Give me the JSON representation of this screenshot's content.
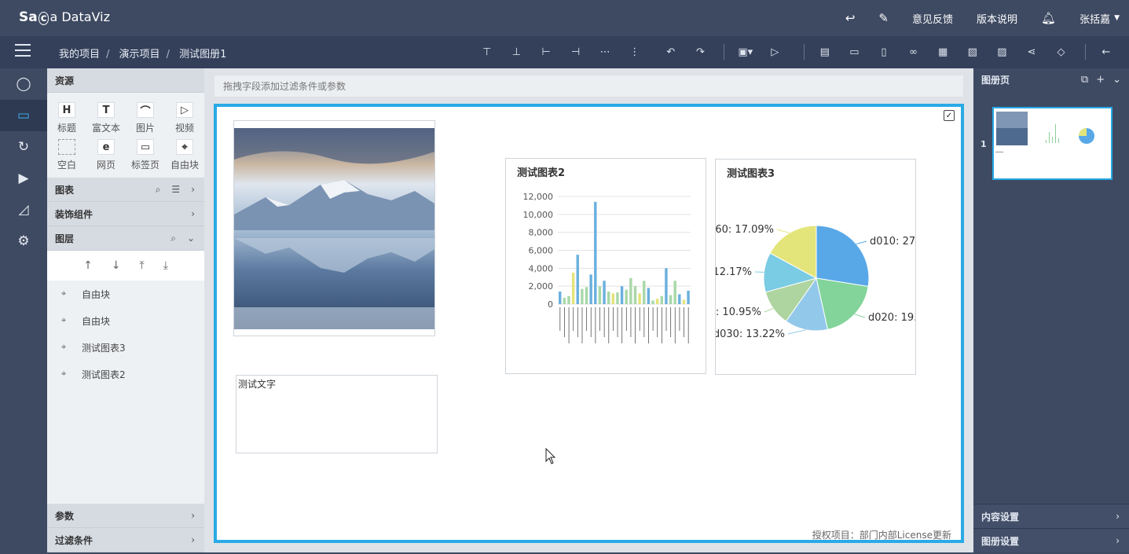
{
  "app": {
    "logo_a": "Sa",
    "logo_mid": "c",
    "logo_b": "a DataViz"
  },
  "topnav": {
    "feedback": "意见反馈",
    "release_notes": "版本说明",
    "user": "张括嘉"
  },
  "breadcrumb": {
    "items": [
      "我的项目",
      "演示项目",
      "测试图册1"
    ]
  },
  "left": {
    "resources_title": "资源",
    "resources": [
      {
        "label": "标题",
        "glyph": "H",
        "icon": "heading-icon"
      },
      {
        "label": "富文本",
        "glyph": "T",
        "icon": "rich-text-icon"
      },
      {
        "label": "图片",
        "glyph": "⌒",
        "icon": "image-icon"
      },
      {
        "label": "视频",
        "glyph": "▷",
        "icon": "video-icon"
      },
      {
        "label": "空白",
        "glyph": "",
        "icon": "blank-icon"
      },
      {
        "label": "网页",
        "glyph": "e",
        "icon": "webpage-icon"
      },
      {
        "label": "标签页",
        "glyph": "▭",
        "icon": "tab-page-icon"
      },
      {
        "label": "自由块",
        "glyph": "⌖",
        "icon": "free-block-icon"
      }
    ],
    "charts_title": "图表",
    "decor_title": "装饰组件",
    "layers_title": "图层",
    "layers": [
      "自由块",
      "自由块",
      "测试图表3",
      "测试图表2"
    ],
    "params_title": "参数",
    "filters_title": "过滤条件"
  },
  "canvas": {
    "filter_placeholder": "拖拽字段添加过滤条件或参数",
    "text_widget": "测试文字",
    "license": "授权项目：部门内部License更新"
  },
  "right": {
    "pages_title": "图册页",
    "page_number": "1",
    "content_settings": "内容设置",
    "album_settings": "图册设置"
  },
  "chart_data": [
    {
      "type": "bar",
      "title": "测试图表2",
      "yticks": [
        "0",
        "2,000",
        "4,000",
        "6,000",
        "8,000",
        "10,000",
        "12,000"
      ],
      "ylim": [
        0,
        12000
      ],
      "values": [
        1400,
        700,
        900,
        3500,
        5500,
        1700,
        1900,
        3300,
        11400,
        2000,
        2600,
        1400,
        1200,
        1300,
        2000,
        1600,
        2900,
        2000,
        1200,
        2600,
        1800,
        400,
        600,
        900,
        4000,
        1000,
        2600,
        1100,
        500,
        1500
      ],
      "colors": [
        "#6ab0de",
        "#a8d8a8",
        "#a8d8a8",
        "#e3e37a",
        "#6ab0de",
        "#a8d8a8",
        "#a8d8a8",
        "#6ab0de",
        "#6ab0de",
        "#a8d8a8",
        "#6ab0de",
        "#a8d8a8",
        "#e3e37a",
        "#a8d8a8",
        "#6ab0de",
        "#a8d8a8",
        "#a8d8a8",
        "#a8d8a8",
        "#e3e37a",
        "#a8d8a8",
        "#6ab0de",
        "#a8d8a8",
        "#e3e37a",
        "#a8d8a8",
        "#6ab0de",
        "#a8d8a8",
        "#a8d8a8",
        "#6ab0de",
        "#e3e37a",
        "#6ab0de"
      ]
    },
    {
      "type": "pie",
      "title": "测试图表3",
      "slices": [
        {
          "label": "d010: 27.",
          "value": 27.5,
          "color": "#58a8e8"
        },
        {
          "label": "d020: 19.",
          "value": 19.0,
          "color": "#82d49a"
        },
        {
          "label": "d030: 13.22%",
          "value": 13.22,
          "color": "#92c8ea"
        },
        {
          "label": ": 10.95%",
          "value": 10.95,
          "color": "#aed4a0"
        },
        {
          "label": "12.17%",
          "value": 12.17,
          "color": "#7acbe4"
        },
        {
          "label": "60: 17.09%",
          "value": 17.09,
          "color": "#e3e57a"
        }
      ]
    }
  ]
}
